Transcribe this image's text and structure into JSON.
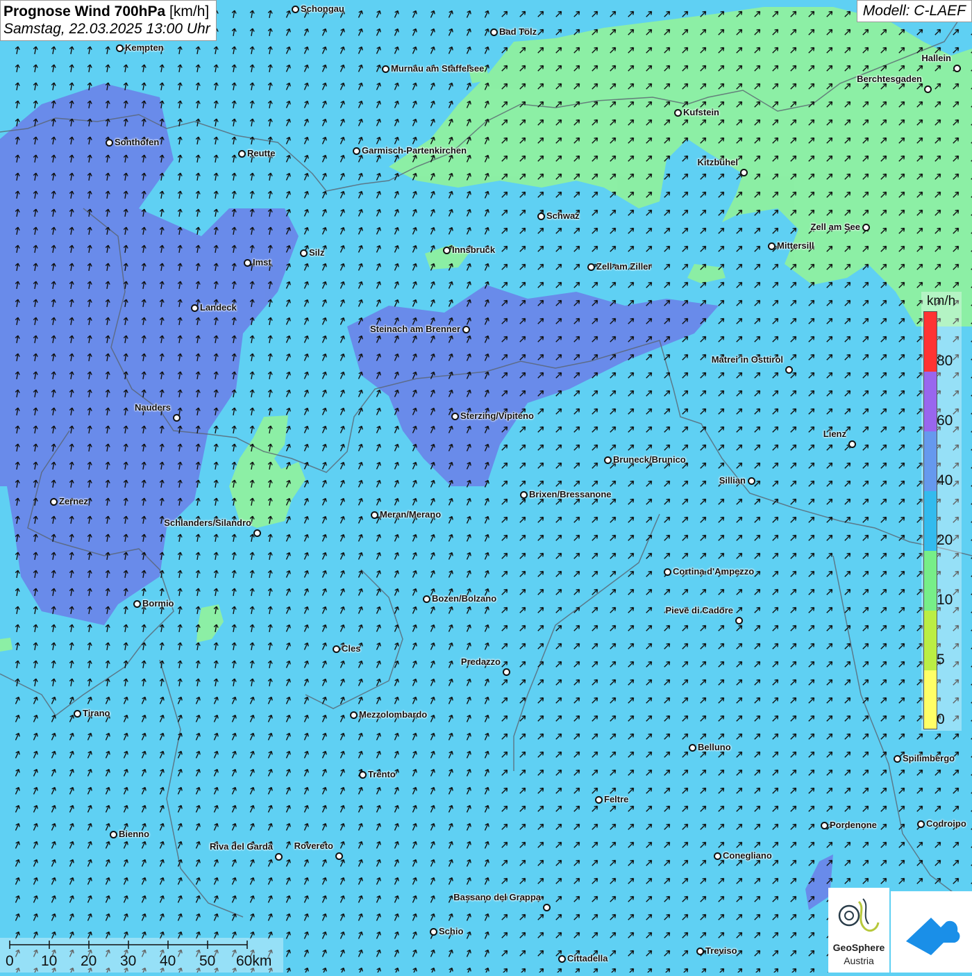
{
  "header": {
    "title_bold": "Prognose Wind 700hPa",
    "title_unit": "[km/h]",
    "datetime": "Samstag, 22.03.2025 13:00 Uhr",
    "model": "Modell: C-LAEF"
  },
  "legend": {
    "unit": "km/h",
    "ticks": [
      "80",
      "60",
      "40",
      "20",
      "10",
      "5",
      "0"
    ],
    "colors": [
      "#ff3333",
      "#9966ee",
      "#6699ee",
      "#33bbee",
      "#77ee88",
      "#bbee44",
      "#ffff66"
    ]
  },
  "scalebar": {
    "labels": [
      "0",
      "10",
      "20",
      "30",
      "40",
      "50",
      "60km"
    ]
  },
  "logos": {
    "geosphere_name": "GeoSphere",
    "geosphere_country": "Austria"
  },
  "map_colors": {
    "background": "#5fd0f3",
    "band_60_40": "#6b7fe8",
    "band_10_20": "#8ef0a0",
    "border": "#5a6470"
  },
  "cities": [
    {
      "name": "Schongau"
    },
    {
      "name": "Bad Tölz"
    },
    {
      "name": "Kempten"
    },
    {
      "name": "Murnau am Staffelsee"
    },
    {
      "name": "Hallein"
    },
    {
      "name": "Berchtesgaden"
    },
    {
      "name": "Kufstein"
    },
    {
      "name": "Sonthofen"
    },
    {
      "name": "Reutte"
    },
    {
      "name": "Garmisch-Partenkirchen"
    },
    {
      "name": "Kitzbühel"
    },
    {
      "name": "Schwaz"
    },
    {
      "name": "Zell am See"
    },
    {
      "name": "Innsbruck"
    },
    {
      "name": "Mittersill"
    },
    {
      "name": "Imst"
    },
    {
      "name": "Silz"
    },
    {
      "name": "Zell am Ziller"
    },
    {
      "name": "Landeck"
    },
    {
      "name": "Steinach am Brenner"
    },
    {
      "name": "Matrei in Osttirol"
    },
    {
      "name": "Nauders"
    },
    {
      "name": "Sterzing/Vipiteno"
    },
    {
      "name": "Lienz"
    },
    {
      "name": "Bruneck/Brunico"
    },
    {
      "name": "Sillian"
    },
    {
      "name": "Brixen/Bressanone"
    },
    {
      "name": "Zernez"
    },
    {
      "name": "Meran/Merano"
    },
    {
      "name": "Schlanders/Silandro"
    },
    {
      "name": "Cortina d'Ampezzo"
    },
    {
      "name": "Bozen/Bolzano"
    },
    {
      "name": "Bormio"
    },
    {
      "name": "Pieve di Cadore"
    },
    {
      "name": "Cles"
    },
    {
      "name": "Predazzo"
    },
    {
      "name": "Tirano"
    },
    {
      "name": "Mezzolombardo"
    },
    {
      "name": "Belluno"
    },
    {
      "name": "Spilimbergo"
    },
    {
      "name": "Trento"
    },
    {
      "name": "Feltre"
    },
    {
      "name": "Pordenone"
    },
    {
      "name": "Codroipo"
    },
    {
      "name": "Bienno"
    },
    {
      "name": "Riva del Garda"
    },
    {
      "name": "Rovereto"
    },
    {
      "name": "Conegliano"
    },
    {
      "name": "Bassano del Grappa"
    },
    {
      "name": "Schio"
    },
    {
      "name": "Treviso"
    },
    {
      "name": "Cittadella"
    }
  ]
}
